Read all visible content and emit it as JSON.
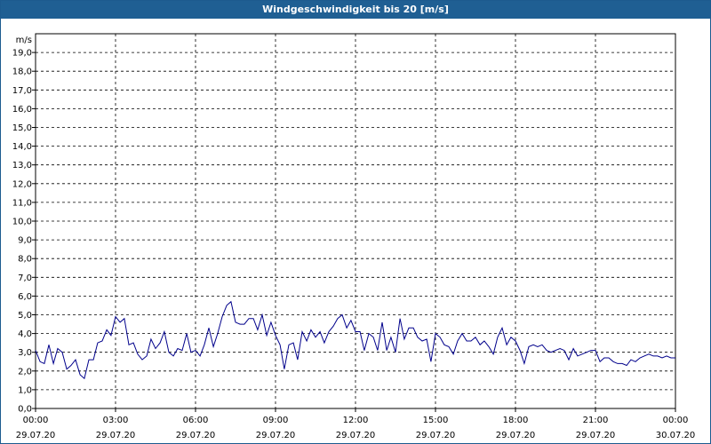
{
  "window": {
    "title": "Windgeschwindigkeit bis 20 [m/s]"
  },
  "chart_data": {
    "type": "line",
    "title": "Windgeschwindigkeit bis 20 [m/s]",
    "ylabel": "m/s",
    "xlabel": "",
    "ylim": [
      0,
      20
    ],
    "xlim_hours": [
      0,
      24
    ],
    "grid": true,
    "line_color": "#00008b",
    "yticks": [
      "0,0",
      "1,0",
      "2,0",
      "3,0",
      "4,0",
      "5,0",
      "6,0",
      "7,0",
      "8,0",
      "9,0",
      "10,0",
      "11,0",
      "12,0",
      "13,0",
      "14,0",
      "15,0",
      "16,0",
      "17,0",
      "18,0",
      "19,0"
    ],
    "xticks": [
      {
        "time": "00:00",
        "date": "29.07.20"
      },
      {
        "time": "03:00",
        "date": "29.07.20"
      },
      {
        "time": "06:00",
        "date": "29.07.20"
      },
      {
        "time": "09:00",
        "date": "29.07.20"
      },
      {
        "time": "12:00",
        "date": "29.07.20"
      },
      {
        "time": "15:00",
        "date": "29.07.20"
      },
      {
        "time": "18:00",
        "date": "29.07.20"
      },
      {
        "time": "21:00",
        "date": "29.07.20"
      },
      {
        "time": "00:00",
        "date": "30.07.20"
      }
    ],
    "series": [
      {
        "x_hours": [
          0.0,
          0.17,
          0.33,
          0.5,
          0.67,
          0.83,
          1.0,
          1.17,
          1.33,
          1.5,
          1.67,
          1.83,
          2.0,
          2.17,
          2.33,
          2.5,
          2.67,
          2.83,
          3.0,
          3.17,
          3.33,
          3.5,
          3.67,
          3.83,
          4.0,
          4.17,
          4.33,
          4.5,
          4.67,
          4.83,
          5.0,
          5.17,
          5.33,
          5.5,
          5.67,
          5.83,
          6.0,
          6.17,
          6.33,
          6.5,
          6.67,
          6.83,
          7.0,
          7.17,
          7.33,
          7.5,
          7.67,
          7.83,
          8.0,
          8.17,
          8.33,
          8.5,
          8.67,
          8.83,
          9.0,
          9.17,
          9.33,
          9.5,
          9.67,
          9.83,
          10.0,
          10.17,
          10.33,
          10.5,
          10.67,
          10.83,
          11.0,
          11.17,
          11.33,
          11.5,
          11.67,
          11.83,
          12.0,
          12.17,
          12.33,
          12.5,
          12.67,
          12.83,
          13.0,
          13.17,
          13.33,
          13.5,
          13.67,
          13.83,
          14.0,
          14.17,
          14.33,
          14.5,
          14.67,
          14.83,
          15.0,
          15.17,
          15.33,
          15.5,
          15.67,
          15.83,
          16.0,
          16.17,
          16.33,
          16.5,
          16.67,
          16.83,
          17.0,
          17.17,
          17.33,
          17.5,
          17.67,
          17.83,
          18.0,
          18.17,
          18.33,
          18.5,
          18.67,
          18.83,
          19.0,
          19.17,
          19.33,
          19.5,
          19.67,
          19.83,
          20.0,
          20.17,
          20.33,
          20.5,
          20.67,
          20.83,
          21.0,
          21.17,
          21.33,
          21.5,
          21.67,
          21.83,
          22.0,
          22.17,
          22.33,
          22.5,
          22.67,
          22.83,
          23.0,
          23.17,
          23.33,
          23.5,
          23.67,
          23.83,
          24.0
        ],
        "values": [
          3.1,
          2.5,
          2.4,
          3.4,
          2.4,
          3.2,
          3.0,
          2.1,
          2.3,
          2.6,
          1.8,
          1.6,
          2.6,
          2.6,
          3.5,
          3.6,
          4.2,
          3.9,
          4.9,
          4.6,
          4.8,
          3.4,
          3.5,
          2.9,
          2.6,
          2.8,
          3.7,
          3.2,
          3.5,
          4.1,
          3.0,
          2.8,
          3.2,
          3.1,
          4.0,
          3.0,
          3.1,
          2.8,
          3.4,
          4.3,
          3.3,
          4.0,
          4.9,
          5.5,
          5.7,
          4.6,
          4.5,
          4.5,
          4.8,
          4.8,
          4.2,
          5.0,
          3.9,
          4.6,
          3.9,
          3.4,
          2.1,
          3.4,
          3.5,
          2.6,
          4.1,
          3.6,
          4.2,
          3.8,
          4.1,
          3.5,
          4.1,
          4.4,
          4.8,
          5.0,
          4.3,
          4.7,
          4.1,
          4.1,
          3.1,
          4.0,
          3.8,
          3.1,
          4.6,
          3.1,
          3.8,
          3.0,
          4.8,
          3.7,
          4.3,
          4.3,
          3.8,
          3.6,
          3.7,
          2.5,
          4.0,
          3.8,
          3.4,
          3.3,
          2.9,
          3.6,
          4.0,
          3.6,
          3.6,
          3.8,
          3.4,
          3.6,
          3.3,
          2.9,
          3.8,
          4.3,
          3.4,
          3.8,
          3.6,
          3.1,
          2.4,
          3.3,
          3.4,
          3.3,
          3.4,
          3.1,
          3.0,
          3.1,
          3.2,
          3.1,
          2.6,
          3.2,
          2.8,
          2.9,
          3.0,
          3.1,
          3.1,
          2.5,
          2.7,
          2.7,
          2.5,
          2.4,
          2.4,
          2.3,
          2.6,
          2.5,
          2.7,
          2.8,
          2.9,
          2.8,
          2.8,
          2.7,
          2.8,
          2.7,
          2.7,
          2.6,
          2.5
        ]
      }
    ]
  }
}
